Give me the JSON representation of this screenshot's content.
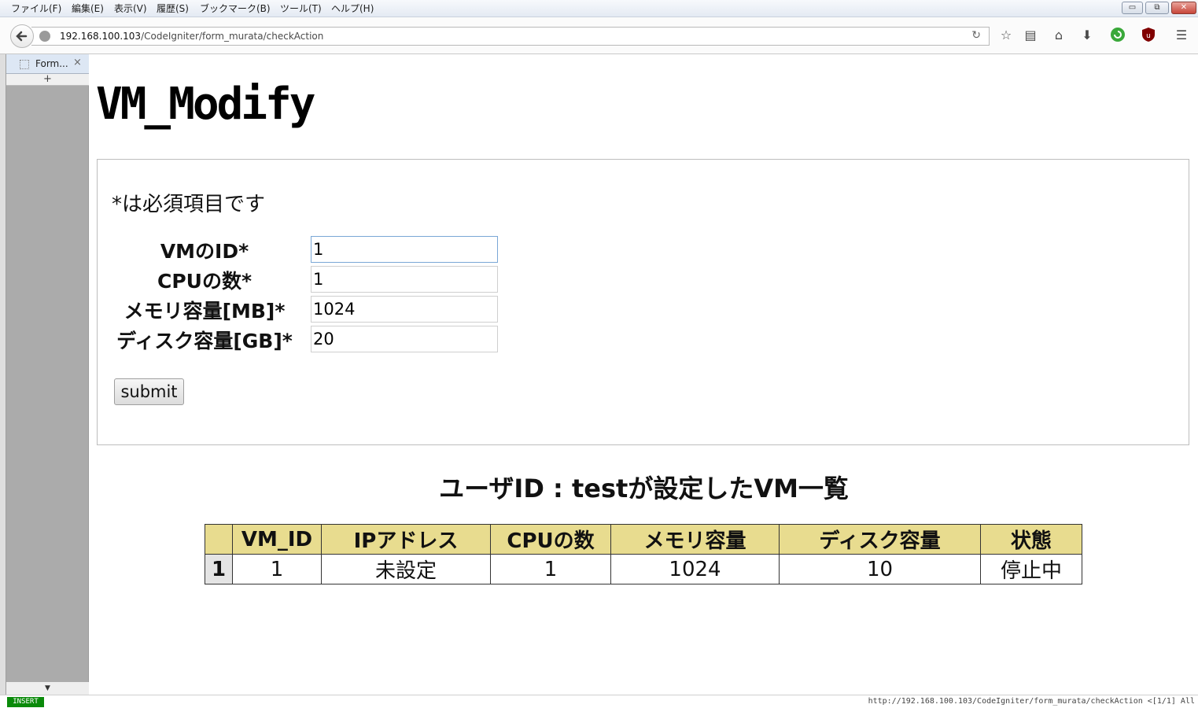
{
  "menubar": {
    "items": [
      "ファイル(F)",
      "編集(E)",
      "表示(V)",
      "履歴(S)",
      "ブックマーク(B)",
      "ツール(T)",
      "ヘルプ(H)"
    ],
    "window_controls": {
      "minimize": "▭",
      "restore": "⧉",
      "close": "✕"
    }
  },
  "navbar": {
    "url_host": "192.168.100.103",
    "url_path": "/CodeIgniter/form_murata/checkAction",
    "icons": [
      "back-icon",
      "reload-icon",
      "star-icon",
      "reading-list-icon",
      "home-icon",
      "download-icon",
      "green-refresh-icon",
      "ublock-icon",
      "menu-icon"
    ]
  },
  "tabs": [
    {
      "label": "Form...",
      "close": "×"
    }
  ],
  "new_tab_label": "+",
  "page": {
    "title": "VM_Modify",
    "required_note": "*は必須項目です",
    "fields": [
      {
        "label": "VMのID*",
        "value": "1"
      },
      {
        "label": "CPUの数*",
        "value": "1"
      },
      {
        "label": "メモリ容量[MB]*",
        "value": "1024"
      },
      {
        "label": "ディスク容量[GB]*",
        "value": "20"
      }
    ],
    "submit_label": "submit",
    "list_heading": "ユーザID : testが設定したVM一覧",
    "table": {
      "headers": [
        "",
        "VM_ID",
        "IPアドレス",
        "CPUの数",
        "メモリ容量",
        "ディスク容量",
        "状態"
      ],
      "rows": [
        [
          "1",
          "1",
          "未設定",
          "1",
          "1024",
          "10",
          "停止中"
        ]
      ]
    }
  },
  "statusbar": {
    "mode": "INSERT",
    "url": "http://192.168.100.103/CodeIgniter/form_murata/checkAction <[1/1] All"
  },
  "colors": {
    "table_header_bg": "#e8dc8f",
    "mode_indicator_bg": "#0a8a0a"
  }
}
